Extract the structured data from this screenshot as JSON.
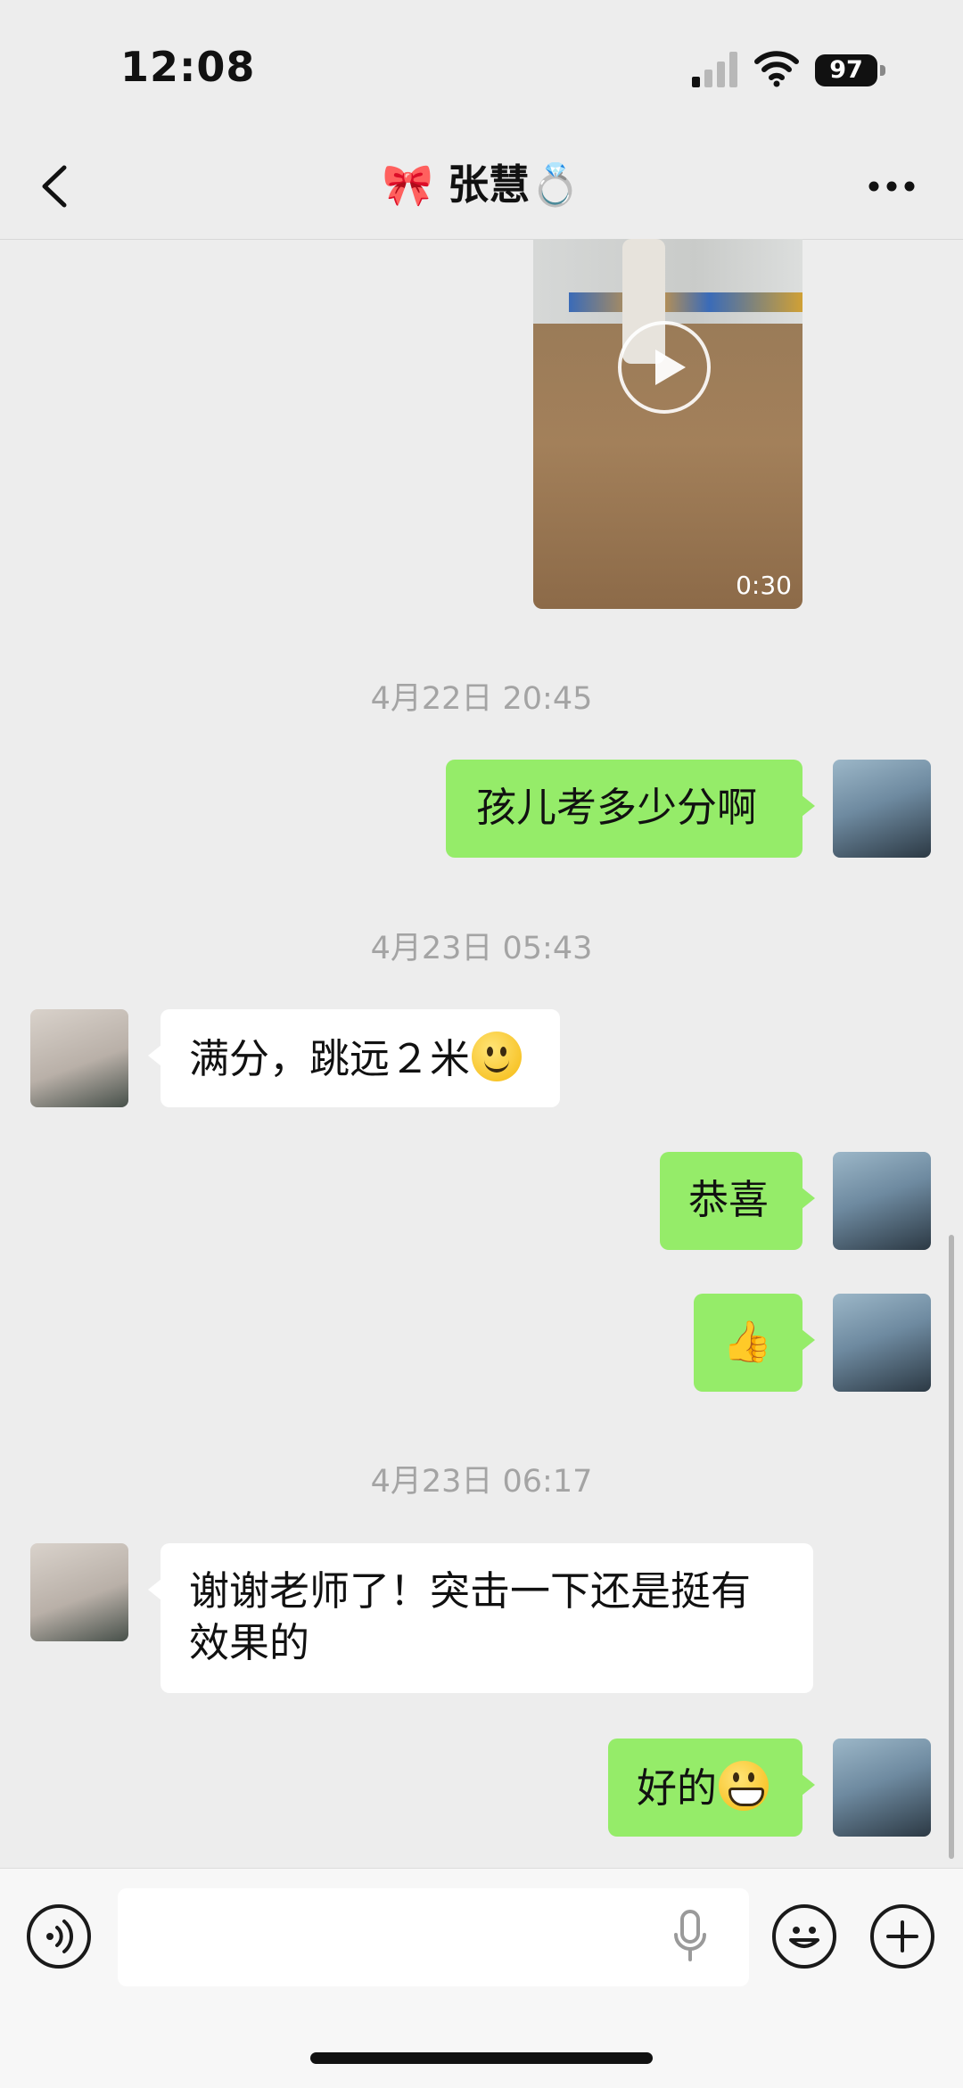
{
  "status_bar": {
    "time": "12:08",
    "battery": "97"
  },
  "nav": {
    "title": "🎀 张慧💍",
    "back_icon": "chevron-left-icon",
    "more_icon": "ellipsis-icon"
  },
  "video": {
    "duration": "0:30"
  },
  "messages": {
    "t1": "4月22日 20:45",
    "m1": "孩儿考多少分啊",
    "t2": "4月23日 05:43",
    "m2": "满分，跳远２米",
    "m3": "恭喜",
    "m4": "👍",
    "t3": "4月23日 06:17",
    "m5_line1": "谢谢老师了！突击一下还是挺有",
    "m5_line2": "效果的",
    "m6": "好的"
  },
  "input_bar": {
    "voice_icon": "voice-icon",
    "mic_icon": "mic-icon",
    "emoji_icon": "emoji-icon",
    "plus_icon": "plus-icon"
  }
}
